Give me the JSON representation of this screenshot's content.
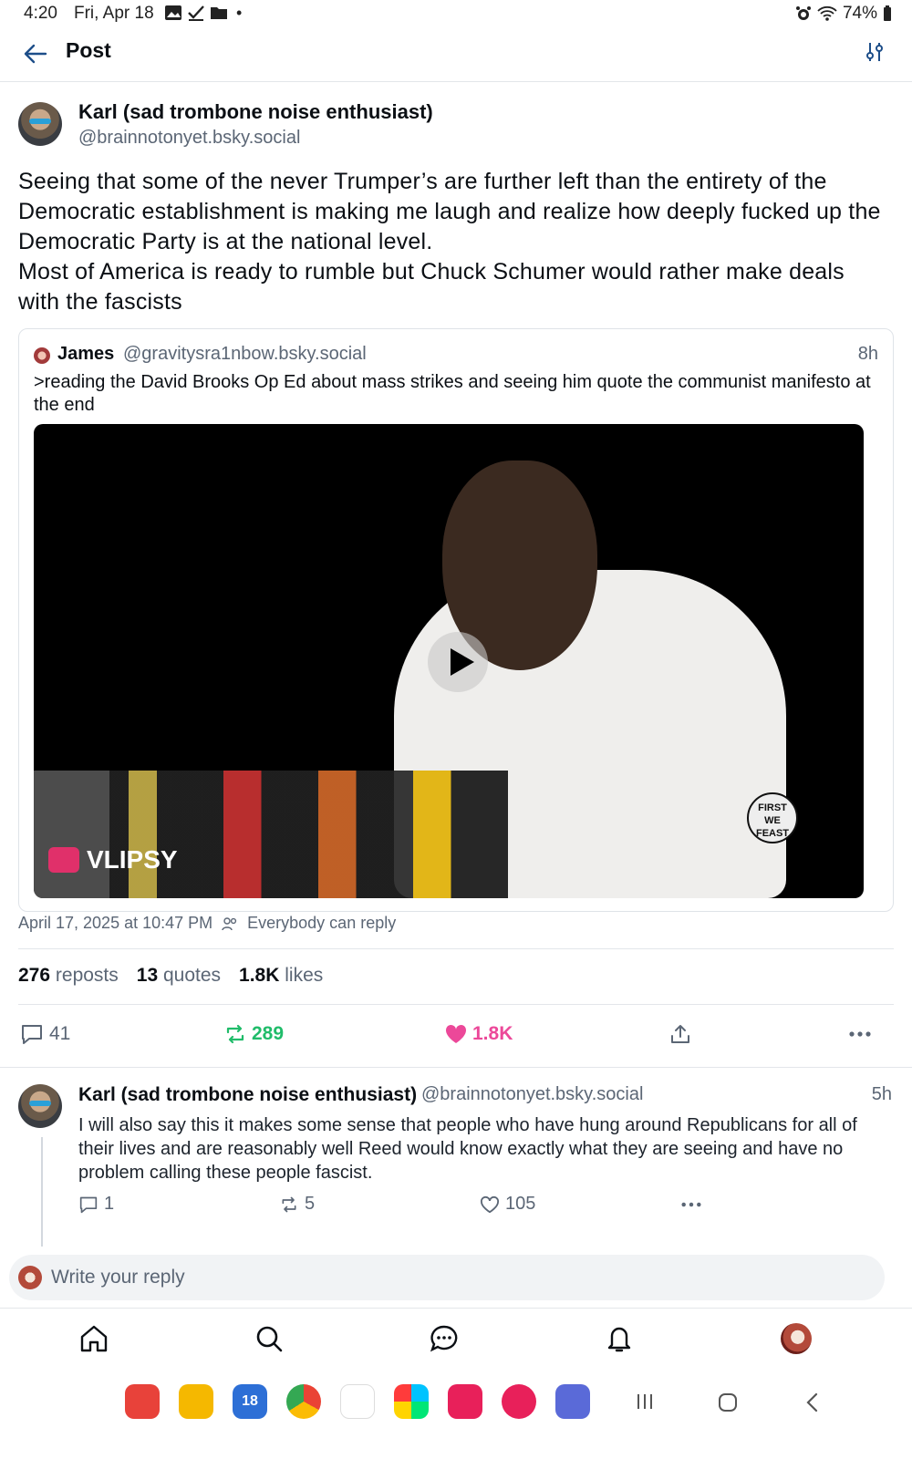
{
  "status": {
    "time": "4:20",
    "date": "Fri, Apr 18",
    "battery": "74%"
  },
  "header": {
    "title": "Post"
  },
  "post": {
    "author_name": "Karl (sad trombone noise enthusiast)",
    "author_handle": "@brainnotonyet.bsky.social",
    "text": "Seeing that some of the never Trumper’s are further left than the entirety of the Democratic establishment is making me laugh and realize how deeply fucked up the Democratic Party is at the national level.\nMost of America is ready to rumble but Chuck Schumer would rather make deals with the fascists",
    "timestamp": "April 17, 2025 at 10:47 PM",
    "reply_setting": "Everybody can reply",
    "reposts_count": "276",
    "reposts_label": "reposts",
    "quotes_count": "13",
    "quotes_label": "quotes",
    "likes_count": "1.8K",
    "likes_label": "likes",
    "actions": {
      "replies": "41",
      "reposts": "289",
      "likes": "1.8K"
    },
    "colors": {
      "repost": "#20bc6a",
      "like": "#ec4899"
    }
  },
  "quote": {
    "name": "James",
    "handle": "@gravitysra1nbow.bsky.social",
    "time": "8h",
    "text": ">reading the David Brooks Op Ed about mass strikes and seeing him quote the communist manifesto at the end",
    "video_watermark": "VLIPSY",
    "badge_text": "FIRST WE FEAST"
  },
  "reply": {
    "name": "Karl (sad trombone noise enthusiast)",
    "handle": "@brainnotonyet.bsky.social",
    "time": "5h",
    "text": "I will also say this it makes some sense that people who have hung around Republicans for all of their lives and are reasonably well Reed would know exactly what they are seeing and have no problem calling these people fascist.",
    "replies": "1",
    "reposts": "5",
    "likes": "105"
  },
  "composer": {
    "placeholder": "Write your reply"
  },
  "tabs": [
    "home-icon",
    "search-icon",
    "chat-icon",
    "notifications-icon",
    "profile-avatar"
  ],
  "system": {
    "calendar_day": "18"
  }
}
